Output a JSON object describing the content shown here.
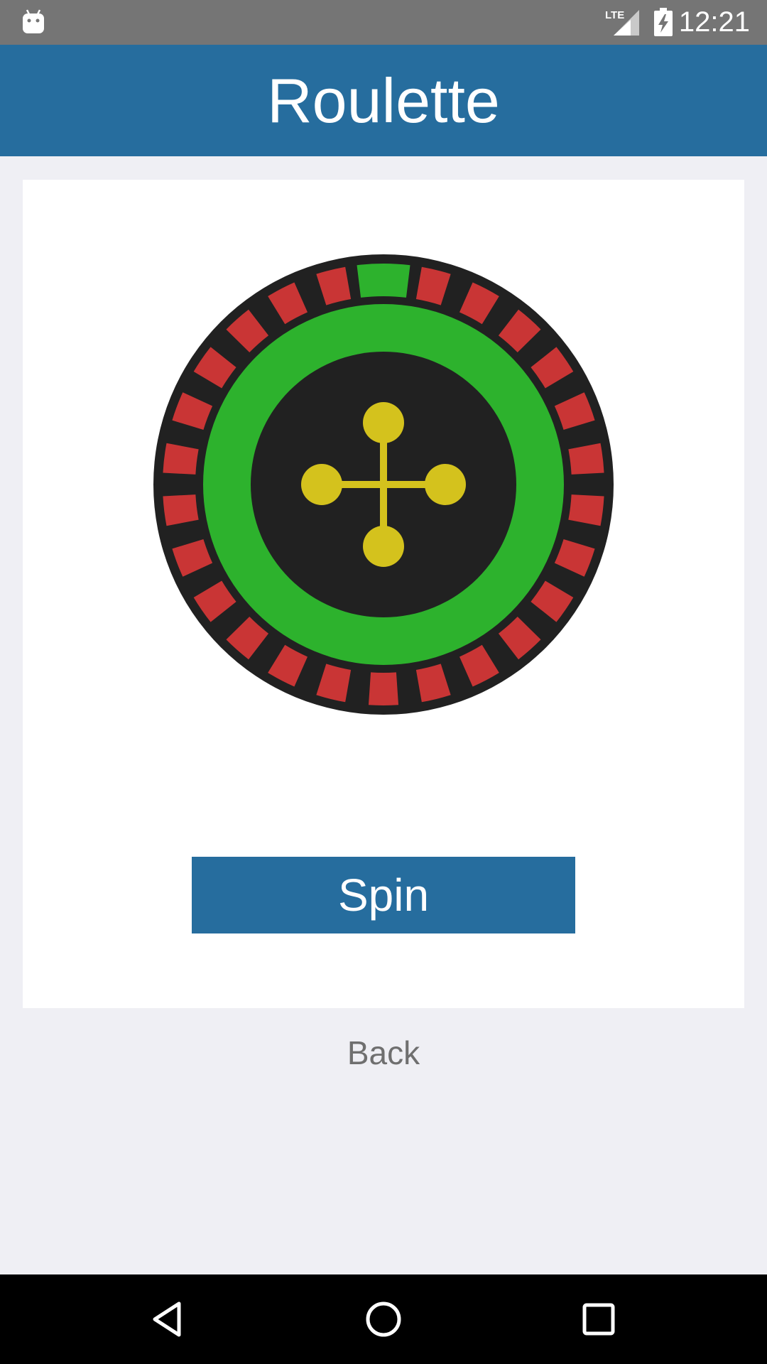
{
  "status_bar": {
    "time": "12:21",
    "network": "LTE",
    "icons": [
      "android-icon",
      "signal-icon",
      "battery-charging-icon"
    ]
  },
  "app_bar": {
    "title": "Roulette"
  },
  "wheel": {
    "pocket_count": 26,
    "zero_pocket_color": "#2db22d",
    "pocket_color": "#c93535",
    "rim_color": "#212121",
    "track_color": "#2db22d",
    "turret_color": "#d4c21d"
  },
  "actions": {
    "spin_label": "Spin",
    "back_label": "Back"
  },
  "nav_bar": {
    "icons": [
      "back-triangle-icon",
      "home-circle-icon",
      "recents-square-icon"
    ]
  },
  "colors": {
    "primary": "#266d9e",
    "background": "#efeff4",
    "status_bar": "#757575"
  }
}
